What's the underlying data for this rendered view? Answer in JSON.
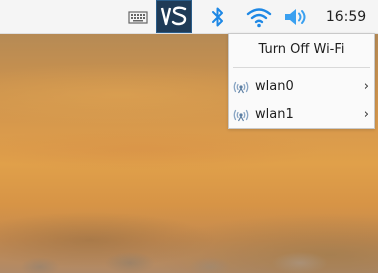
{
  "taskbar": {
    "clock": "16:59",
    "icons": [
      "keyboard-icon",
      "vnc-icon",
      "bluetooth-icon",
      "wifi-icon",
      "volume-icon"
    ],
    "accent_color": "#1e88e5"
  },
  "network_menu": {
    "toggle_label": "Turn Off Wi-Fi",
    "interfaces": [
      {
        "label": "wlan0",
        "arrow": "›"
      },
      {
        "label": "wlan1",
        "arrow": "›"
      }
    ]
  }
}
